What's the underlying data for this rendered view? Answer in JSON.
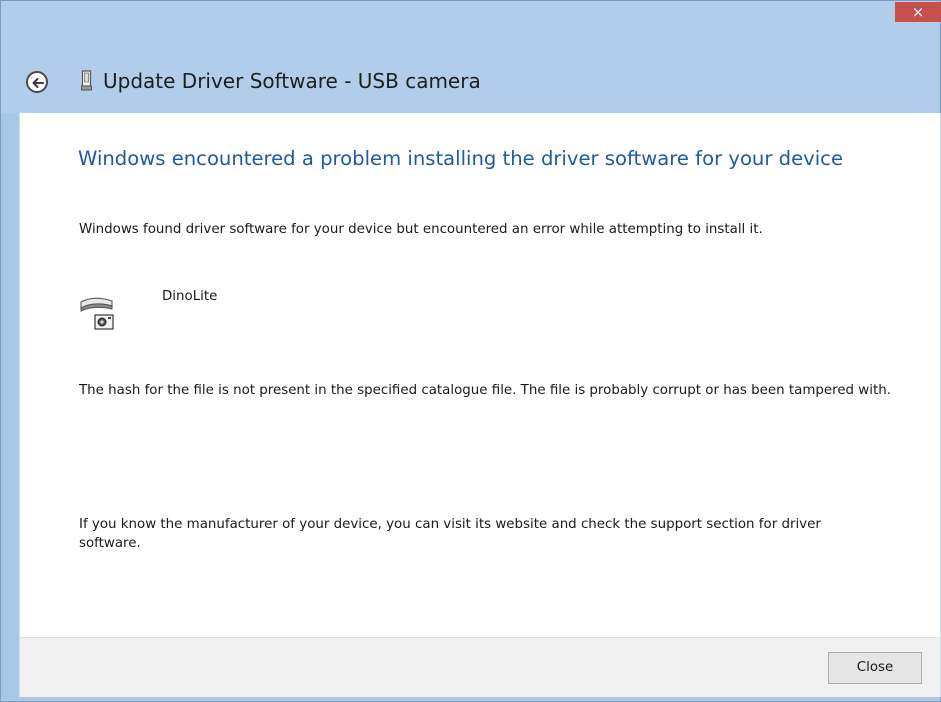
{
  "window": {
    "title": "Update Driver Software - USB camera",
    "close_glyph": "×"
  },
  "content": {
    "heading": "Windows encountered a problem installing the driver software for your device",
    "intro": "Windows found driver software for your device but encountered an error while attempting to install it.",
    "device_name": "DinoLite",
    "error_text": "The hash for the file is not present in the specified catalogue file. The file is probably corrupt or has been tampered with.",
    "help_text": "If you know the manufacturer of your device, you can visit its website and check the support section for driver software."
  },
  "footer": {
    "close_label": "Close"
  },
  "icons": {
    "back": "back-arrow-icon",
    "title": "usb-device-icon",
    "device": "usb-camera-icon"
  },
  "colors": {
    "titlebar": "#b1cde9",
    "close_button_bg": "#c7504d",
    "heading": "#1c5aa8",
    "footer_bg": "#f0f0f0"
  }
}
